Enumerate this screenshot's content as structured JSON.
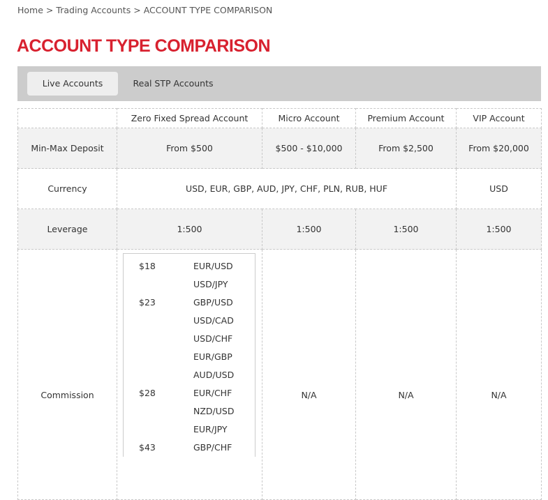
{
  "breadcrumb": {
    "home": "Home",
    "sep": ">",
    "trading": "Trading Accounts",
    "current": "ACCOUNT TYPE COMPARISON"
  },
  "page_title": "ACCOUNT TYPE COMPARISON",
  "tabs": [
    {
      "label": "Live Accounts",
      "active": true
    },
    {
      "label": "Real STP Accounts",
      "active": false
    }
  ],
  "colors": {
    "title": "#d8212f",
    "tabbar": "#cccccc",
    "row_shade": "#f2f2f2"
  },
  "table": {
    "headers": [
      "",
      "Zero Fixed Spread Account",
      "Micro Account",
      "Premium Account",
      "VIP Account"
    ],
    "deposit": {
      "label": "Min-Max Deposit",
      "values": [
        "From $500",
        "$500 - $10,000",
        "From $2,500",
        "From $20,000"
      ]
    },
    "currency": {
      "label": "Currency",
      "shared": "USD, EUR, GBP, AUD, JPY, CHF, PLN, RUB, HUF",
      "vip": "USD"
    },
    "leverage": {
      "label": "Leverage",
      "values": [
        "1:500",
        "1:500",
        "1:500",
        "1:500"
      ]
    },
    "commission": {
      "label": "Commission",
      "zero_fixed": [
        {
          "price": "$18",
          "pair": "EUR/USD"
        },
        {
          "price": "",
          "pair": "USD/JPY"
        },
        {
          "price": "$23",
          "pair": "GBP/USD"
        },
        {
          "price": "",
          "pair": "USD/CAD"
        },
        {
          "price": "",
          "pair": "USD/CHF"
        },
        {
          "price": "",
          "pair": "EUR/GBP"
        },
        {
          "price": "",
          "pair": "AUD/USD"
        },
        {
          "price": "$28",
          "pair": "EUR/CHF"
        },
        {
          "price": "",
          "pair": "NZD/USD"
        },
        {
          "price": "",
          "pair": "EUR/JPY"
        },
        {
          "price": "$43",
          "pair": "GBP/CHF"
        }
      ],
      "micro": "N/A",
      "premium": "N/A",
      "vip": "N/A"
    }
  }
}
